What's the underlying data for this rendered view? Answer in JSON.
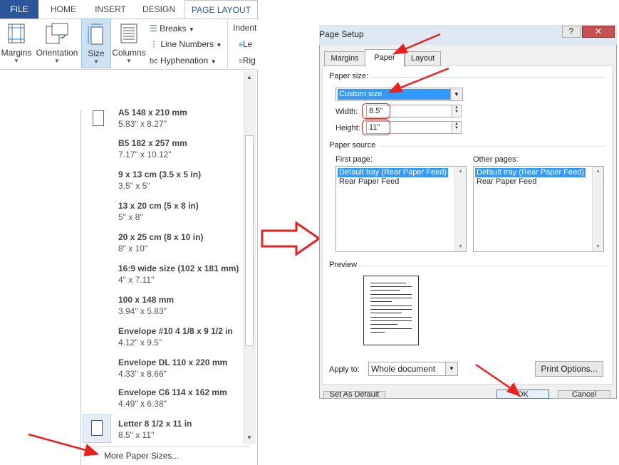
{
  "ribbon": {
    "tabs": [
      "FILE",
      "HOME",
      "INSERT",
      "DESIGN",
      "PAGE LAYOUT"
    ],
    "buttons": {
      "margins": "Margins",
      "orientation": "Orientation",
      "size": "Size",
      "columns": "Columns"
    },
    "small": {
      "breaks": "Breaks",
      "line_numbers": "Line Numbers",
      "hyphenation": "Hyphenation",
      "indent": "Indent",
      "left": "Le",
      "right": "Rig"
    }
  },
  "paper_sizes": [
    {
      "name": "A5 148 x 210 mm",
      "dims": "5.83\" x 8.27\""
    },
    {
      "name": "B5 182 x 257 mm",
      "dims": "7.17\" x 10.12\""
    },
    {
      "name": "9 x 13 cm (3.5 x 5 in)",
      "dims": "3.5\" x 5\""
    },
    {
      "name": "13 x 20 cm (5 x 8 in)",
      "dims": "5\" x 8\""
    },
    {
      "name": "20 x 25 cm (8 x 10 in)",
      "dims": "8\" x 10\""
    },
    {
      "name": "16:9 wide size (102 x 181 mm)",
      "dims": "4\" x 7.11\""
    },
    {
      "name": "100 x 148 mm",
      "dims": "3.94\" x 5.83\""
    },
    {
      "name": "Envelope #10 4 1/8 x 9 1/2 in",
      "dims": "4.12\" x 9.5\""
    },
    {
      "name": "Envelope DL  110 x 220 mm",
      "dims": "4.33\" x 8.66\""
    },
    {
      "name": "Envelope C6  114 x 162 mm",
      "dims": "4.49\" x 6.38\""
    },
    {
      "name": "Letter 8 1/2 x 11 in",
      "dims": "8.5\" x 11\""
    }
  ],
  "more_paper_sizes": "More Paper Sizes...",
  "dialog": {
    "title": "Page Setup",
    "help": "?",
    "tabs": [
      "Margins",
      "Paper",
      "Layout"
    ],
    "paper_size_label": "Paper size:",
    "paper_size_value": "Custom size",
    "width_label": "Width:",
    "width_value": "8.5\"",
    "height_label": "Height:",
    "height_value": "11\"",
    "paper_source_label": "Paper source",
    "first_page_label": "First page:",
    "other_pages_label": "Other pages:",
    "first_page_items": [
      "Default tray (Rear Paper Feed)",
      "Rear Paper Feed"
    ],
    "other_pages_items": [
      "Default tray (Rear Paper Feed)",
      "Rear Paper Feed"
    ],
    "preview_label": "Preview",
    "apply_to_label": "Apply to:",
    "apply_to_value": "Whole document",
    "print_options": "Print Options...",
    "set_as_default": "Set As Default",
    "ok": "OK",
    "cancel": "Cancel"
  },
  "colors": {
    "accent": "#2b579a",
    "selection": "#3399ff",
    "annotation": "#e82020"
  }
}
